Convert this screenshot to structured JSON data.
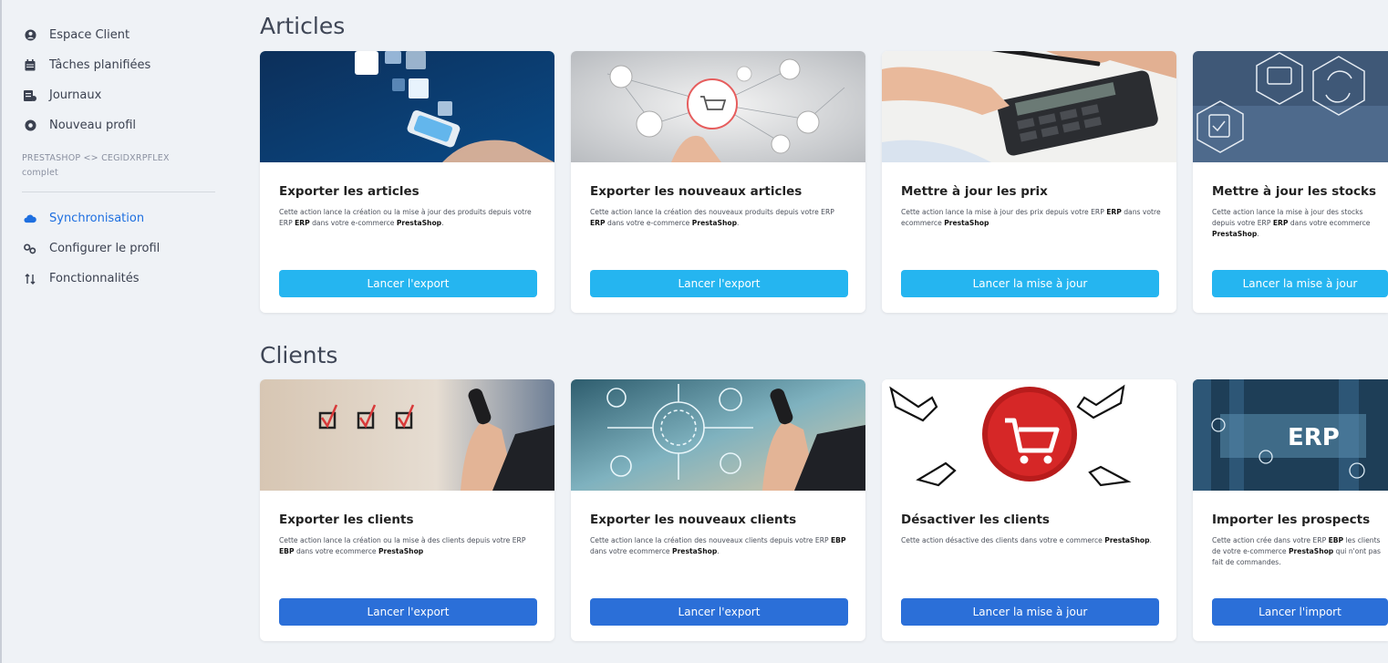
{
  "sidebar": {
    "items": [
      {
        "label": "Espace Client",
        "icon": "user-circle-icon"
      },
      {
        "label": "Tâches planifiées",
        "icon": "calendar-icon"
      },
      {
        "label": "Journaux",
        "icon": "log-icon"
      },
      {
        "label": "Nouveau profil",
        "icon": "plus-circle-icon"
      }
    ],
    "group_label": "PRESTASHOP <> CEGIDXRPFLEX complet",
    "profile_items": [
      {
        "label": "Synchronisation",
        "icon": "cloud-icon",
        "active": true
      },
      {
        "label": "Configurer le profil",
        "icon": "gears-icon",
        "active": false
      },
      {
        "label": "Fonctionnalités",
        "icon": "sort-arrows-icon",
        "active": false
      }
    ]
  },
  "colors": {
    "accent": "#1e6fe0",
    "button_light": "#25b5f0",
    "button_dark": "#2b6fd8",
    "background": "#eff2f6"
  },
  "sections": [
    {
      "title": "Articles",
      "cards": [
        {
          "title": "Exporter les articles",
          "desc_pre": "Cette action lance la création ou la mise à jour des produits depuis votre ERP ",
          "desc_bold1": "ERP",
          "desc_mid": " dans votre e-commerce ",
          "desc_bold2": "PrestaShop",
          "desc_post": ".",
          "button": "Lancer l'export",
          "image": "shopping-tablet-image"
        },
        {
          "title": "Exporter les nouveaux articles",
          "desc_pre": "Cette action lance la création des nouveaux produits depuis votre ERP ",
          "desc_bold1": "ERP",
          "desc_mid": " dans votre e-commerce ",
          "desc_bold2": "PrestaShop",
          "desc_post": ".",
          "button": "Lancer l'export",
          "image": "cart-network-image"
        },
        {
          "title": "Mettre à jour les prix",
          "desc_pre": "Cette action lance la mise à jour des prix depuis votre ERP ",
          "desc_bold1": "ERP",
          "desc_mid": " dans votre ecommerce ",
          "desc_bold2": "PrestaShop",
          "desc_post": "",
          "button": "Lancer la mise à jour",
          "image": "calculator-image"
        },
        {
          "title": "Mettre à jour les stocks",
          "desc_pre": "Cette action lance la mise à jour des stocks depuis votre ERP ",
          "desc_bold1": "ERP",
          "desc_mid": " dans votre ecommerce ",
          "desc_bold2": "PrestaShop",
          "desc_post": ".",
          "button": "Lancer la mise à jour",
          "image": "stock-icons-image"
        }
      ]
    },
    {
      "title": "Clients",
      "cards": [
        {
          "title": "Exporter les clients",
          "desc_pre": "Cette action lance la création ou la mise à des clients depuis votre ERP ",
          "desc_bold1": "EBP",
          "desc_mid": " dans votre ecommerce ",
          "desc_bold2": "PrestaShop",
          "desc_post": "",
          "button": "Lancer l'export",
          "image": "checkboxes-image"
        },
        {
          "title": "Exporter les nouveaux clients",
          "desc_pre": "Cette action lance la création des nouveaux clients depuis votre ERP ",
          "desc_bold1": "EBP",
          "desc_mid": " dans votre ecommerce ",
          "desc_bold2": "PrestaShop",
          "desc_post": ".",
          "button": "Lancer l'export",
          "image": "tech-circles-image"
        },
        {
          "title": "Désactiver les clients",
          "desc_pre": "Cette action désactive des clients dans votre e commerce ",
          "desc_bold1": "",
          "desc_mid": "",
          "desc_bold2": "PrestaShop",
          "desc_post": ".",
          "button": "Lancer la mise à jour",
          "image": "red-cart-image"
        },
        {
          "title": "Importer les prospects",
          "desc_pre": "Cette action crée dans votre ERP ",
          "desc_bold1": "EBP",
          "desc_mid": " les clients de votre e-commerce ",
          "desc_bold2": "PrestaShop",
          "desc_post": " qui n'ont pas fait de commandes.",
          "button": "Lancer l'import",
          "image": "erp-image"
        }
      ]
    }
  ]
}
